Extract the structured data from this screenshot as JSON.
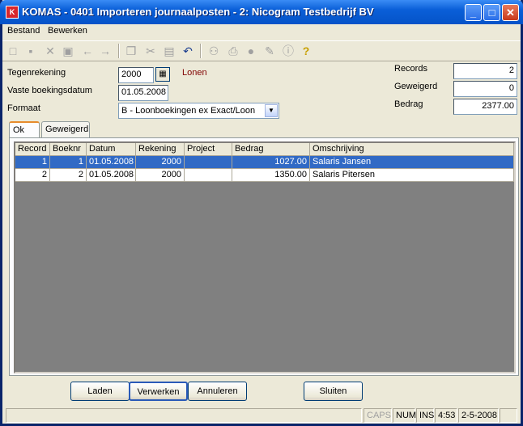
{
  "window": {
    "title": "KOMAS - 0401 Importeren journaalposten - 2: Nicogram Testbedrijf BV",
    "app_icon": "K",
    "minimize": "_",
    "maximize": "□",
    "close": "✕"
  },
  "menu": [
    {
      "label": "Bestand",
      "accel": "B"
    },
    {
      "label": "Bewerken",
      "accel": "w"
    }
  ],
  "toolbar_icons": [
    "new-icon",
    "save-icon",
    "delete-icon",
    "saveas-icon",
    "back-arrow-icon",
    "forward-arrow-icon",
    "copy-icon",
    "cut-icon",
    "paste-icon",
    "undo-icon",
    "binoculars-icon",
    "print-icon",
    "bell-icon",
    "edit-icon",
    "info-icon",
    "help-icon"
  ],
  "form": {
    "tegenrekening_label": "Tegenrekening",
    "tegenrekening_value": "2000",
    "tegenrekening_name": "Lonen",
    "vaste_label": "Vaste boekingsdatum",
    "vaste_value": "01.05.2008",
    "formaat_label": "Formaat",
    "formaat_value": "B - Loonboekingen ex Exact/Loon",
    "records_label": "Records",
    "records_value": "2",
    "geweigerd_label": "Geweigerd",
    "geweigerd_value": "0",
    "bedrag_label": "Bedrag",
    "bedrag_value": "2377.00"
  },
  "tabs": [
    {
      "label": "Ok",
      "active": true
    },
    {
      "label": "Geweigerd",
      "active": false
    }
  ],
  "grid": {
    "columns": [
      "Record",
      "Boeknr",
      "Datum",
      "Rekening",
      "Project",
      "Bedrag",
      "Omschrijving"
    ],
    "rows": [
      [
        "1",
        "1",
        "01.05.2008",
        "2000",
        "",
        "1027.00",
        "Salaris Jansen"
      ],
      [
        "2",
        "2",
        "01.05.2008",
        "2000",
        "",
        "1350.00",
        "Salaris Pitersen"
      ]
    ],
    "selected_row": 0,
    "selection_color": "#316ac5"
  },
  "buttons": {
    "laden": "Laden",
    "verwerken": "Verwerken",
    "annuleren": "Annuleren",
    "sluiten": "Sluiten"
  },
  "status": {
    "caps": "CAPS",
    "num": "NUM",
    "ins": "INS",
    "time": "4:53",
    "date": "2-5-2008"
  },
  "colors": {
    "title_bar": "#0553c8",
    "account_name": "#800000",
    "active_tab_accent": "#e68b2c"
  }
}
